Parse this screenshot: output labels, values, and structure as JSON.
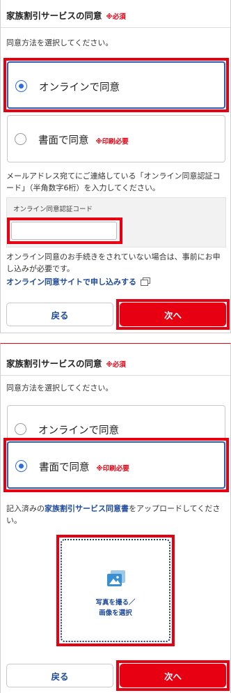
{
  "panel1": {
    "header": {
      "title": "家族割引サービスの同意",
      "required": "※必須"
    },
    "instruction": "同意方法を選択してください。",
    "options": [
      {
        "label": "オンラインで同意",
        "selected": true,
        "note": ""
      },
      {
        "label": "書面で同意",
        "selected": false,
        "note": "※印刷必要"
      }
    ],
    "code_instruction": "メールアドレス宛てにご連絡している「オンライン同意認証コード」（半角数字6桁）を入力してください。",
    "code_field": {
      "caption": "オンライン同意認証コード",
      "value": "",
      "placeholder": ""
    },
    "notice": "オンライン同意のお手続きをされていない場合は、事前にお申し込みが必要です。",
    "link": {
      "label": "オンライン同意サイトで申し込みする",
      "icon": "external-window-icon"
    },
    "buttons": {
      "back": "戻る",
      "next": "次へ"
    }
  },
  "panel2": {
    "header": {
      "title": "家族割引サービスの同意",
      "required": "※必須"
    },
    "instruction": "同意方法を選択してください。",
    "options": [
      {
        "label": "オンラインで同意",
        "selected": false,
        "note": ""
      },
      {
        "label": "書面で同意",
        "selected": true,
        "note": "※印刷必要"
      }
    ],
    "upload_text": {
      "pre": "記入済みの",
      "link": "家族割引サービス同意書",
      "post": "をアップロードしてください。"
    },
    "upload": {
      "line1": "写真を撮る／",
      "line2": "画像を選択",
      "icon": "image-icon"
    },
    "buttons": {
      "back": "戻る",
      "next": "次へ"
    }
  },
  "colors": {
    "accent_red": "#e60012",
    "link_blue": "#1e4a99",
    "radio_blue": "#2c6fd8"
  }
}
